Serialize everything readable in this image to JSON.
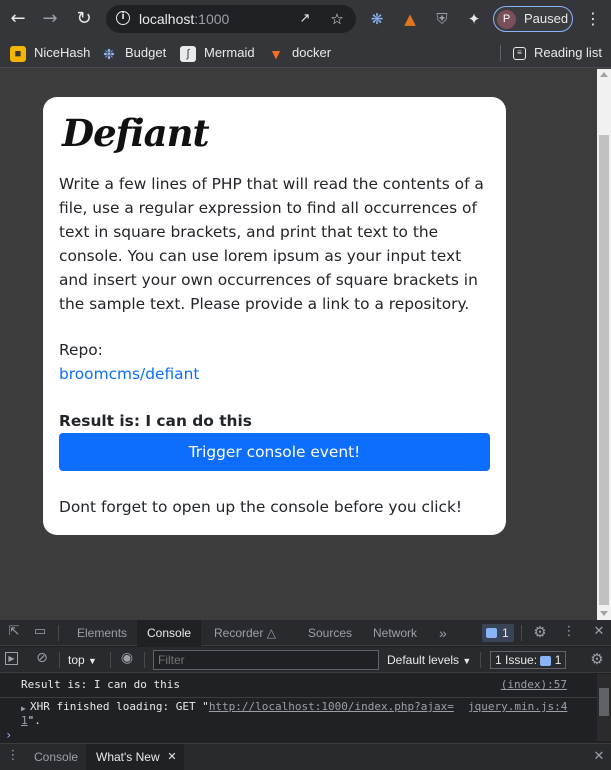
{
  "browser": {
    "url_host": "localhost",
    "url_port": ":1000",
    "profile_initial": "P",
    "profile_status": "Paused"
  },
  "bookmarks": {
    "items": [
      {
        "label": "NiceHash",
        "icon": "nicehash-icon"
      },
      {
        "label": "Budget",
        "icon": "budget-icon"
      },
      {
        "label": "Mermaid",
        "icon": "mermaid-icon"
      },
      {
        "label": "docker",
        "icon": "gitlab-icon"
      }
    ],
    "reading_list": "Reading list"
  },
  "page": {
    "title": "Defiant",
    "description": "Write a few lines of PHP that will read the contents of a file, use a regular expression to find all occurrences of text in square brackets, and print that text to the console. You can use lorem ipsum as your input text and insert your own occurrences of square brackets in the sample text. Please provide a link to a repository.",
    "repo_label": "Repo:",
    "repo_link": "broomcms/defiant",
    "result": "Result is: I can do this",
    "button_label": "Trigger console event!",
    "note": "Dont forget to open up the console before you click!"
  },
  "devtools": {
    "tabs": [
      "Elements",
      "Console",
      "Recorder",
      "Sources",
      "Network"
    ],
    "active_tab": "Console",
    "messages_badge": "1",
    "context": "top",
    "filter_placeholder": "Filter",
    "levels": "Default levels",
    "issues": "1 Issue:",
    "issues_count": "1",
    "console_lines": [
      {
        "text": "Result is: I can do this",
        "source": "(index):57"
      },
      {
        "prefix": "XHR finished loading: GET \"",
        "url": "http://localhost:1000/index.php?ajax=1",
        "url_a": "http://localhost:1000/index.php?ajax=",
        "url_b": "1",
        "suffix": "\".",
        "source_a": "jquery.min.js:4",
        "source_b": ""
      }
    ],
    "drawer_tabs": [
      "Console",
      "What's New"
    ]
  },
  "colors": {
    "accent": "#0d6efd",
    "browser_bar": "#35363a",
    "devtools_bg": "#202124"
  }
}
